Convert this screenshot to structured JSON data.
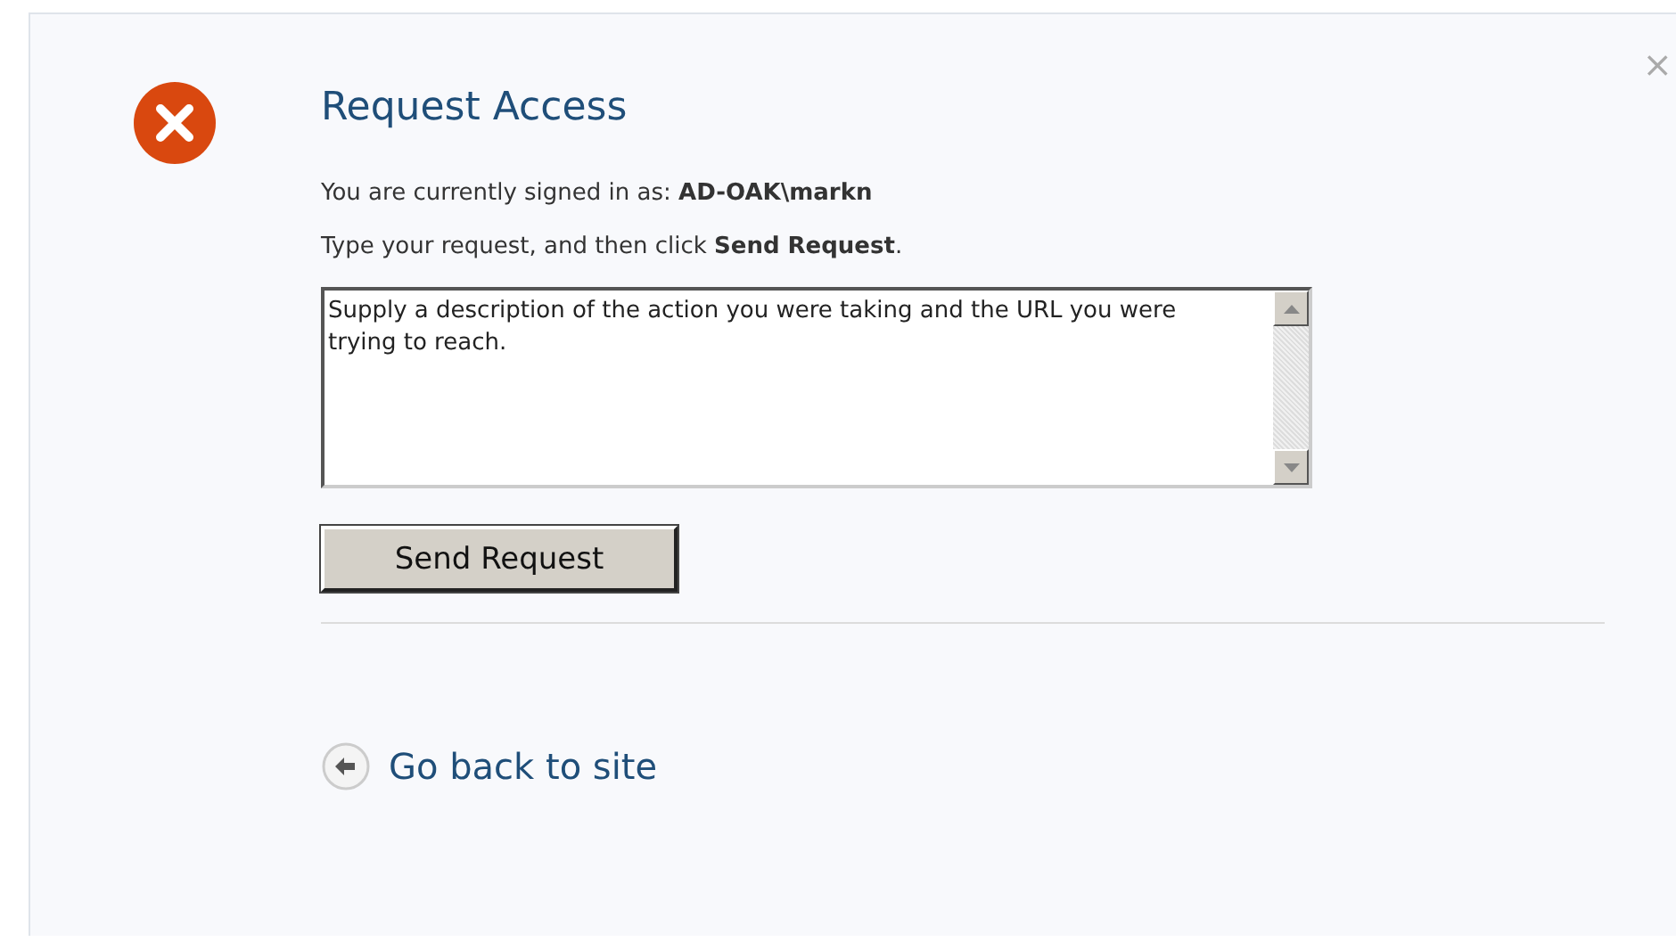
{
  "dialog": {
    "close": "×",
    "title": "Request Access",
    "signed_in": "You are currently signed in as:  **AD-OAK\\markn**",
    "instruction": "Type your request, and then click **Send Request**.",
    "request_field": {
      "value": "Supply a description of the action you were taking and the URL you were trying to reach."
    },
    "send_button": "Send Request",
    "back_link": "Go back to site"
  }
}
